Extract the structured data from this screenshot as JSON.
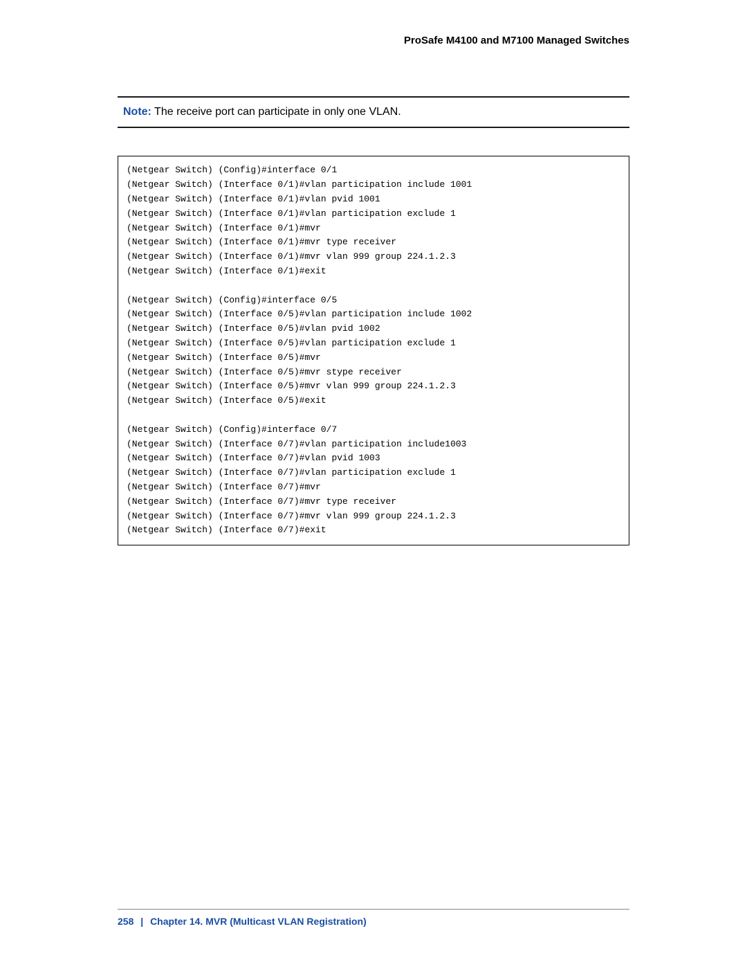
{
  "header": {
    "title": "ProSafe M4100 and M7100 Managed Switches"
  },
  "note": {
    "label": "Note:",
    "text": "The receive port can participate in only one VLAN."
  },
  "code": {
    "lines": [
      "(Netgear Switch) (Config)#interface 0/1",
      "(Netgear Switch) (Interface 0/1)#vlan participation include 1001",
      "(Netgear Switch) (Interface 0/1)#vlan pvid 1001",
      "(Netgear Switch) (Interface 0/1)#vlan participation exclude 1",
      "(Netgear Switch) (Interface 0/1)#mvr",
      "(Netgear Switch) (Interface 0/1)#mvr type receiver",
      "(Netgear Switch) (Interface 0/1)#mvr vlan 999 group 224.1.2.3",
      "(Netgear Switch) (Interface 0/1)#exit",
      "",
      "(Netgear Switch) (Config)#interface 0/5",
      "(Netgear Switch) (Interface 0/5)#vlan participation include 1002",
      "(Netgear Switch) (Interface 0/5)#vlan pvid 1002",
      "(Netgear Switch) (Interface 0/5)#vlan participation exclude 1",
      "(Netgear Switch) (Interface 0/5)#mvr",
      "(Netgear Switch) (Interface 0/5)#mvr stype receiver",
      "(Netgear Switch) (Interface 0/5)#mvr vlan 999 group 224.1.2.3",
      "(Netgear Switch) (Interface 0/5)#exit",
      "",
      "(Netgear Switch) (Config)#interface 0/7",
      "(Netgear Switch) (Interface 0/7)#vlan participation include1003",
      "(Netgear Switch) (Interface 0/7)#vlan pvid 1003",
      "(Netgear Switch) (Interface 0/7)#vlan participation exclude 1",
      "(Netgear Switch) (Interface 0/7)#mvr",
      "(Netgear Switch) (Interface 0/7)#mvr type receiver",
      "(Netgear Switch) (Interface 0/7)#mvr vlan 999 group 224.1.2.3",
      "(Netgear Switch) (Interface 0/7)#exit"
    ]
  },
  "footer": {
    "page_number": "258",
    "separator": "|",
    "chapter": "Chapter 14.  MVR (Multicast VLAN Registration)"
  }
}
